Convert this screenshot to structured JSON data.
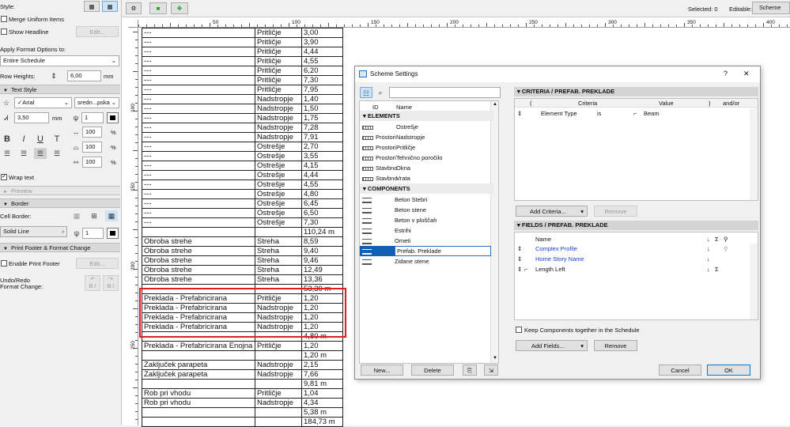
{
  "left_panel": {
    "style_label": "Style:",
    "merge_uniform": "Merge Uniform Items",
    "show_headline": "Show Headline",
    "edit": "Edit...",
    "apply_format_label": "Apply Format Options to:",
    "apply_format_value": "Entire Schedule",
    "row_heights_label": "Row Heights:",
    "row_height_value": "6,00",
    "row_height_unit": "mm",
    "text_style_header": "Text Style",
    "font_name": "Arial",
    "font_style": "sredn...pska",
    "font_size": "3,50",
    "font_size_unit": "mm",
    "pen": "1",
    "bold": "B",
    "italic": "I",
    "underline": "U",
    "strike": "T",
    "width_pct": "100",
    "height_pct": "100",
    "spacing_pct": "100",
    "pct": "%",
    "wrap_text": "Wrap text",
    "preview": "Preview",
    "border_header": "Border",
    "cell_border_label": "Cell Border:",
    "line_type": "Solid Line",
    "border_pen": "1",
    "print_footer_header": "Print Footer & Format Change",
    "enable_print_footer": "Enable Print Footer",
    "undo_redo": "Undo/Redo",
    "format_change": "Format Change:",
    "undo_icon_text": "B /",
    "redo_icon_text": "B /"
  },
  "topbar": {
    "selected": "Selected: 0",
    "editable": "Editable: 0",
    "scheme_button": "Scheme"
  },
  "ruler": {
    "ticks": [
      "50",
      "100",
      "150",
      "200",
      "250",
      "300",
      "350",
      "400"
    ],
    "left_ticks": [
      "100",
      "150",
      "200",
      "250"
    ]
  },
  "schedule_rows": [
    [
      "---",
      "Pritličje",
      "3,00"
    ],
    [
      "---",
      "Pritličje",
      "3,90"
    ],
    [
      "---",
      "Pritličje",
      "4,44"
    ],
    [
      "---",
      "Pritličje",
      "4,55"
    ],
    [
      "---",
      "Pritličje",
      "6,20"
    ],
    [
      "---",
      "Pritličje",
      "7,30"
    ],
    [
      "---",
      "Pritličje",
      "7,95"
    ],
    [
      "---",
      "Nadstropje",
      "1,40"
    ],
    [
      "---",
      "Nadstropje",
      "1,50"
    ],
    [
      "---",
      "Nadstropje",
      "1,75"
    ],
    [
      "---",
      "Nadstropje",
      "7,28"
    ],
    [
      "---",
      "Nadstropje",
      "7,91"
    ],
    [
      "---",
      "Ostrešje",
      "2,70"
    ],
    [
      "---",
      "Ostrešje",
      "3,55"
    ],
    [
      "---",
      "Ostrešje",
      "4,15"
    ],
    [
      "---",
      "Ostrešje",
      "4,44"
    ],
    [
      "---",
      "Ostrešje",
      "4,55"
    ],
    [
      "---",
      "Ostrešje",
      "4,80"
    ],
    [
      "---",
      "Ostrešje",
      "6,45"
    ],
    [
      "---",
      "Ostrešje",
      "6,50"
    ],
    [
      "---",
      "Ostrešje",
      "7,30"
    ],
    [
      "",
      "",
      "110,24 m"
    ],
    [
      "Obroba strehe",
      "Streha",
      "8,59"
    ],
    [
      "Obroba strehe",
      "Streha",
      "9,40"
    ],
    [
      "Obroba strehe",
      "Streha",
      "9,46"
    ],
    [
      "Obroba strehe",
      "Streha",
      "12,49"
    ],
    [
      "Obroba strehe",
      "Streha",
      "13,36"
    ],
    [
      "",
      "",
      "53,30 m"
    ],
    [
      "Preklada - Prefabricirana",
      "Pritličje",
      "1,20"
    ],
    [
      "Preklada - Prefabricirana",
      "Nadstropje",
      "1,20"
    ],
    [
      "Preklada - Prefabricirana",
      "Nadstropje",
      "1,20"
    ],
    [
      "Preklada - Prefabricirana",
      "Nadstropje",
      "1,20"
    ],
    [
      "",
      "",
      "4,80 m"
    ],
    [
      "Preklada - Prefabricirana Enojna",
      "Pritličje",
      "1,20"
    ],
    [
      "",
      "",
      "1,20 m"
    ],
    [
      "Zaključek parapeta",
      "Nadstropje",
      "2,15"
    ],
    [
      "Zaključek parapeta",
      "Nadstropje",
      "7,66"
    ],
    [
      "",
      "",
      "9,81 m"
    ],
    [
      "Rob pri vhodu",
      "Pritličje",
      "1,04"
    ],
    [
      "Rob pri vhodu",
      "Nadstropje",
      "4,34"
    ],
    [
      "",
      "",
      "5,38 m"
    ],
    [
      "",
      "",
      "184,73 m"
    ]
  ],
  "dialog": {
    "title": "Scheme Settings",
    "help": "?",
    "close": "✕",
    "col_id": "ID",
    "col_name": "Name",
    "elements_header": "ELEMENTS",
    "elements": [
      {
        "id": "",
        "name": "Ostrešje"
      },
      {
        "id": "Prostori",
        "name": "Nadstropje"
      },
      {
        "id": "Prostori",
        "name": "Pritličje"
      },
      {
        "id": "Prostori",
        "name": "Tehnično poročilo"
      },
      {
        "id": "Stavbno",
        "name": "Okna"
      },
      {
        "id": "Stavbno",
        "name": "Vrata"
      }
    ],
    "components_header": "COMPONENTS",
    "components": [
      "Beton Stebri",
      "Beton stene",
      "Beton v ploščah",
      "Estrihi",
      "Ometi",
      "Prefab. Preklade",
      "Zidane stene"
    ],
    "selected_component": "Prefab. Preklade",
    "new_btn": "New...",
    "delete_btn": "Delete",
    "criteria_header": "CRITERIA / PREFAB. PREKLADE",
    "crit_cols": [
      "(",
      "Criteria",
      "Value",
      ")",
      "and/or"
    ],
    "crit_row": {
      "criteria": "Element Type",
      "op": "is",
      "value": "Beam"
    },
    "add_criteria": "Add Criteria...",
    "remove_criteria": "Remove",
    "fields_header": "FIELDS / PREFAB. PREKLADE",
    "fields_col_name": "Name",
    "fields": [
      {
        "name": "Complex Profile",
        "link": true,
        "sum": "",
        "arrow": "↓"
      },
      {
        "name": "Home Story Name",
        "link": true,
        "sum": "",
        "arrow": "↓"
      },
      {
        "name": "Length Left",
        "link": false,
        "sum": "Σ",
        "arrow": "↓"
      }
    ],
    "keep_together": "Keep Components together in the Schedule",
    "add_fields": "Add Fields...",
    "remove_fields": "Remove",
    "cancel": "Cancel",
    "ok": "OK"
  },
  "colors": {
    "accent": "#0078d7",
    "highlight": "#e02020",
    "link": "#1a3fd0"
  }
}
